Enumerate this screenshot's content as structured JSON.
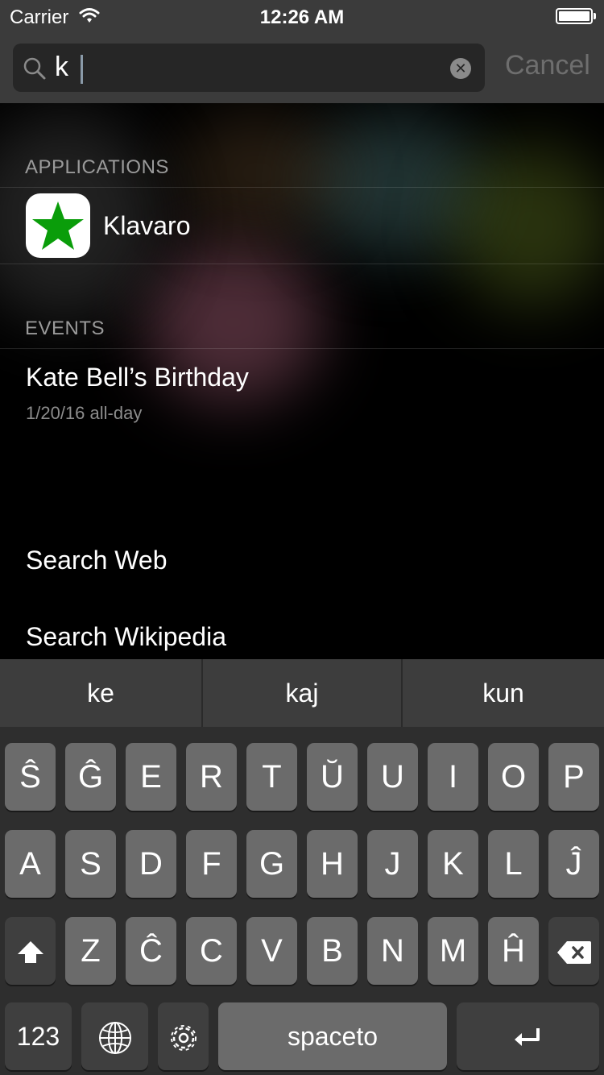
{
  "status_bar": {
    "carrier": "Carrier",
    "time": "12:26 AM"
  },
  "search": {
    "query": "k",
    "cancel_label": "Cancel"
  },
  "sections": {
    "applications": {
      "header": "APPLICATIONS",
      "app_name": "Klavaro",
      "app_icon": "star-icon",
      "app_icon_color": "#0a9d0a"
    },
    "events": {
      "header": "EVENTS",
      "title": "Kate Bell’s Birthday",
      "date": "1/20/16 all-day"
    }
  },
  "web_actions": {
    "search_web": "Search Web",
    "search_wikipedia": "Search Wikipedia"
  },
  "keyboard": {
    "suggestions": [
      "ke",
      "kaj",
      "kun"
    ],
    "row1": [
      "Ŝ",
      "Ĝ",
      "E",
      "R",
      "T",
      "Ŭ",
      "U",
      "I",
      "O",
      "P"
    ],
    "row2": [
      "A",
      "S",
      "D",
      "F",
      "G",
      "H",
      "J",
      "K",
      "L",
      "Ĵ"
    ],
    "row3": [
      "Z",
      "Ĉ",
      "C",
      "V",
      "B",
      "N",
      "M",
      "Ĥ"
    ],
    "numbers_label": "123",
    "space_label": "spaceto",
    "shift_icon": "shift-icon",
    "delete_icon": "delete-icon",
    "globe_icon": "globe-icon",
    "settings_icon": "gear-icon",
    "return_icon": "return-icon"
  }
}
